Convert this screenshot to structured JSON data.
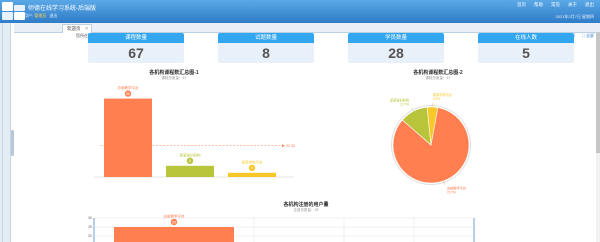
{
  "header": {
    "title": "师德在线学习系统-后端版",
    "links": [
      "首页",
      "帮助",
      "常见",
      "关于",
      "退出"
    ],
    "user": {
      "prefix": "用户:",
      "role": "管理员",
      "exit": "退出"
    },
    "date": "2021年2月7日 星期四"
  },
  "tabs": [
    {
      "label": "欢迎页",
      "close": "✕"
    }
  ],
  "breadcrumb": "您所在的位置：欢迎页",
  "tools": {
    "refresh": "⟳ 刷新",
    "fullscreen": "⛶ 全屏"
  },
  "stats": [
    {
      "label": "课程数量",
      "value": "67"
    },
    {
      "label": "试题数量",
      "value": "8"
    },
    {
      "label": "学员数量",
      "value": "28"
    },
    {
      "label": "在线人数",
      "value": "5"
    }
  ],
  "charts": {
    "bar1": {
      "title": "各机构课程数汇总图-1",
      "subtitle": "课程总数量：67"
    },
    "pie": {
      "title": "各机构课程数汇总图-2",
      "subtitle": "课程总数量：67"
    },
    "reg": {
      "title": "各机构注册的用户量",
      "subtitle": "注册总数量：28"
    }
  },
  "chart_data": [
    {
      "type": "bar",
      "title": "各机构课程数汇总图-1",
      "categories": [
        "总部教学平台",
        "某某培训机构",
        "某某学校平台"
      ],
      "values": [
        56,
        8,
        3
      ],
      "colors": [
        "#ff7f50",
        "#b8c43a",
        "#f7c827"
      ],
      "markline": {
        "value": 22.33
      },
      "ylim": [
        0,
        60
      ]
    },
    {
      "type": "pie",
      "title": "各机构课程数汇总图-2",
      "slices": [
        {
          "name": "总部教学平台",
          "value": 56,
          "label": "总部教学平台 76.7%",
          "color": "#ff7f50"
        },
        {
          "name": "某某培训机构",
          "value": 8,
          "label": "某某培训机构 13.7%",
          "color": "#b8c43a"
        },
        {
          "name": "某某学校平台",
          "value": 3,
          "label": "某某学校平台 9.6%",
          "color": "#f7c827"
        }
      ]
    },
    {
      "type": "bar",
      "title": "各机构注册的用户量",
      "categories": [
        "总部教学平台"
      ],
      "values": [
        25
      ],
      "colors": [
        "#ff7f50"
      ],
      "y_ticks": [
        "30",
        "25",
        "20"
      ],
      "ylim": [
        0,
        30
      ]
    }
  ]
}
